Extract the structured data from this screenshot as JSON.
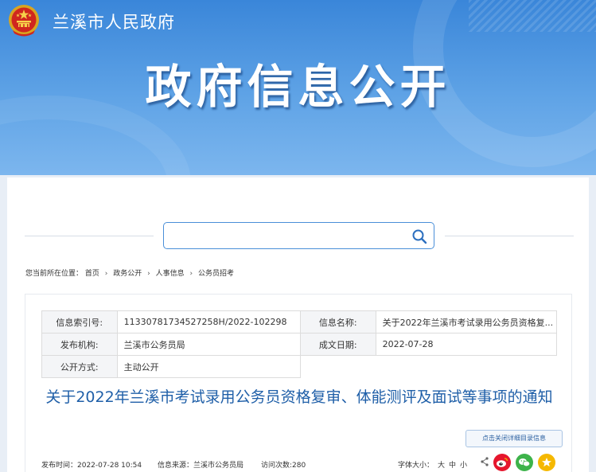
{
  "header": {
    "site_name": "兰溪市人民政府",
    "banner_title": "政府信息公开"
  },
  "search": {
    "placeholder": "",
    "value": ""
  },
  "breadcrumb": {
    "label": "您当前所在位置：",
    "items": [
      "首页",
      "政务公开",
      "人事信息",
      "公务员招考"
    ],
    "separator": "›"
  },
  "meta": {
    "index_label": "信息索引号:",
    "index_value": "11330781734527258H/2022-102298",
    "name_label": "信息名称:",
    "name_value": "关于2022年兰溪市考试录用公务员资格复...",
    "org_label": "发布机构:",
    "org_value": "兰溪市公务员局",
    "date_label": "成文日期:",
    "date_value": "2022-07-28",
    "mode_label": "公开方式:",
    "mode_value": "主动公开"
  },
  "document": {
    "title": "关于2022年兰溪市考试录用公务员资格复审、体能测评及面试等事项的通知",
    "close_catalog": "点击关闭详细目录信息"
  },
  "info_bar": {
    "publish_time": "发布时间：2022-07-28 10:54",
    "source": "信息来源：兰溪市公务员局",
    "views": "访问次数:280",
    "font_size_label": "字体大小：",
    "size_large": "大",
    "size_medium": "中",
    "size_small": "小"
  },
  "icons": {
    "emblem": "national-emblem-icon",
    "search": "search-icon",
    "share": "share-icon",
    "weibo": "weibo-icon",
    "wechat": "wechat-icon",
    "favorite": "star-icon"
  },
  "colors": {
    "banner_blue": "#3a86d9",
    "title_blue": "#1f5fa8",
    "search_border": "#4a8fd8",
    "weibo_red": "#e6162d",
    "wechat_green": "#3db34a",
    "star_yellow": "#f5b800"
  }
}
